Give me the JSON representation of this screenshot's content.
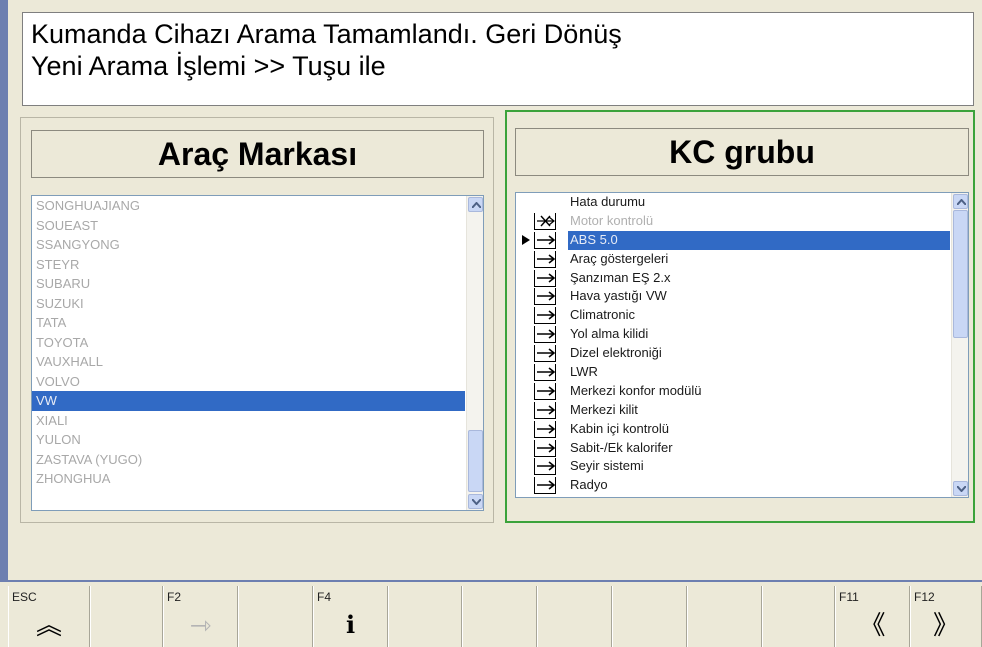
{
  "message": {
    "line1": "Kumanda Cihazı Arama Tamamlandı. Geri Dönüş",
    "line2": "Yeni Arama İşlemi >> Tuşu ile"
  },
  "brand_panel": {
    "title": "Araç Markası",
    "items": [
      "SONGHUAJIANG",
      "SOUEAST",
      "SSANGYONG",
      "STEYR",
      "SUBARU",
      "SUZUKI",
      "TATA",
      "TOYOTA",
      "VAUXHALL",
      "VOLVO",
      "VW",
      "XIALI",
      "YULON",
      "ZASTAVA (YUGO)",
      "ZHONGHUA"
    ],
    "selected": "VW"
  },
  "kc_panel": {
    "title": "KC grubu",
    "items": [
      {
        "label": "Hata durumu",
        "status": "none",
        "dim": false,
        "selected": false
      },
      {
        "label": "Motor kontrolü",
        "status": "cross-icon",
        "dim": true,
        "selected": false
      },
      {
        "label": "ABS 5.0",
        "status": "arrow-icon",
        "dim": false,
        "selected": true
      },
      {
        "label": "Araç göstergeleri",
        "status": "arrow-icon",
        "dim": false,
        "selected": false
      },
      {
        "label": "Şanzıman  EŞ 2.x",
        "status": "arrow-icon",
        "dim": false,
        "selected": false
      },
      {
        "label": "Hava yastığı VW",
        "status": "arrow-icon",
        "dim": false,
        "selected": false
      },
      {
        "label": "Climatronic",
        "status": "arrow-icon",
        "dim": false,
        "selected": false
      },
      {
        "label": "Yol alma kilidi",
        "status": "arrow-icon",
        "dim": false,
        "selected": false
      },
      {
        "label": "Dizel elektroniği",
        "status": "arrow-icon",
        "dim": false,
        "selected": false
      },
      {
        "label": "LWR",
        "status": "arrow-icon",
        "dim": false,
        "selected": false
      },
      {
        "label": "Merkezi konfor modülü",
        "status": "arrow-icon",
        "dim": false,
        "selected": false
      },
      {
        "label": "Merkezi kilit",
        "status": "arrow-icon",
        "dim": false,
        "selected": false
      },
      {
        "label": "Kabin içi kontrolü",
        "status": "arrow-icon",
        "dim": false,
        "selected": false
      },
      {
        "label": "Sabit-/Ek kalorifer",
        "status": "arrow-icon",
        "dim": false,
        "selected": false
      },
      {
        "label": "Seyir sistemi",
        "status": "arrow-icon",
        "dim": false,
        "selected": false
      },
      {
        "label": "Radyo",
        "status": "arrow-icon",
        "dim": false,
        "selected": false
      }
    ]
  },
  "fkeys": [
    {
      "key": "ESC",
      "icon": "double-chevron-up-icon",
      "glyph": "︽",
      "enabled": true
    },
    {
      "key": "",
      "icon": "",
      "glyph": "",
      "enabled": false
    },
    {
      "key": "F2",
      "icon": "arrow-right-icon",
      "glyph": "⇾",
      "enabled": false
    },
    {
      "key": "",
      "icon": "",
      "glyph": "",
      "enabled": false
    },
    {
      "key": "F4",
      "icon": "info-icon",
      "glyph": "i",
      "enabled": true
    },
    {
      "key": "",
      "icon": "",
      "glyph": "",
      "enabled": false
    },
    {
      "key": "",
      "icon": "",
      "glyph": "",
      "enabled": false
    },
    {
      "key": "",
      "icon": "",
      "glyph": "",
      "enabled": false
    },
    {
      "key": "",
      "icon": "",
      "glyph": "",
      "enabled": false
    },
    {
      "key": "",
      "icon": "",
      "glyph": "",
      "enabled": false
    },
    {
      "key": "",
      "icon": "",
      "glyph": "",
      "enabled": false
    },
    {
      "key": "F11",
      "icon": "double-chevron-left-icon",
      "glyph": "《",
      "enabled": true
    },
    {
      "key": "F12",
      "icon": "double-chevron-right-icon",
      "glyph": "》",
      "enabled": true
    }
  ],
  "colors": {
    "selection": "#316ac5",
    "focus_border": "#3ba33b",
    "window_bg": "#ece9d8"
  }
}
